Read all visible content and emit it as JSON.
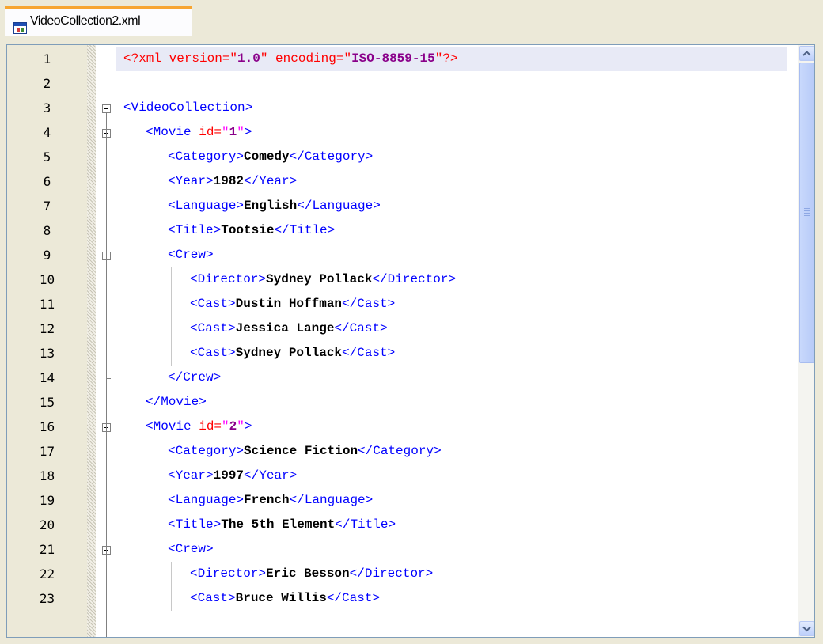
{
  "tab": {
    "label": "VideoCollection2.xml",
    "icon": "xml-file-icon"
  },
  "editor": {
    "current_line": 1,
    "lines": [
      {
        "n": "1",
        "indent": 0,
        "tokens": [
          [
            "pi",
            "<?xml version=\""
          ],
          [
            "val",
            "1.0"
          ],
          [
            "pi",
            "\" encoding=\""
          ],
          [
            "val",
            "ISO-8859-15"
          ],
          [
            "pi",
            "\"?>"
          ]
        ]
      },
      {
        "n": "2",
        "indent": 0,
        "tokens": []
      },
      {
        "n": "3",
        "indent": 0,
        "tokens": [
          [
            "tag",
            "<VideoCollection>"
          ]
        ]
      },
      {
        "n": "4",
        "indent": 1,
        "tokens": [
          [
            "tag",
            "<Movie "
          ],
          [
            "attr",
            "id="
          ],
          [
            "q",
            "\""
          ],
          [
            "val",
            "1"
          ],
          [
            "q",
            "\""
          ],
          [
            "tag",
            ">"
          ]
        ]
      },
      {
        "n": "5",
        "indent": 2,
        "tokens": [
          [
            "tag",
            "<Category>"
          ],
          [
            "txt",
            "Comedy"
          ],
          [
            "tag",
            "</Category>"
          ]
        ]
      },
      {
        "n": "6",
        "indent": 2,
        "tokens": [
          [
            "tag",
            "<Year>"
          ],
          [
            "txt",
            "1982"
          ],
          [
            "tag",
            "</Year>"
          ]
        ]
      },
      {
        "n": "7",
        "indent": 2,
        "tokens": [
          [
            "tag",
            "<Language>"
          ],
          [
            "txt",
            "English"
          ],
          [
            "tag",
            "</Language>"
          ]
        ]
      },
      {
        "n": "8",
        "indent": 2,
        "tokens": [
          [
            "tag",
            "<Title>"
          ],
          [
            "txt",
            "Tootsie"
          ],
          [
            "tag",
            "</Title>"
          ]
        ]
      },
      {
        "n": "9",
        "indent": 2,
        "tokens": [
          [
            "tag",
            "<Crew>"
          ]
        ]
      },
      {
        "n": "10",
        "indent": 3,
        "tokens": [
          [
            "tag",
            "<Director>"
          ],
          [
            "txt",
            "Sydney Pollack"
          ],
          [
            "tag",
            "</Director>"
          ]
        ]
      },
      {
        "n": "11",
        "indent": 3,
        "tokens": [
          [
            "tag",
            "<Cast>"
          ],
          [
            "txt",
            "Dustin Hoffman"
          ],
          [
            "tag",
            "</Cast>"
          ]
        ]
      },
      {
        "n": "12",
        "indent": 3,
        "tokens": [
          [
            "tag",
            "<Cast>"
          ],
          [
            "txt",
            "Jessica Lange"
          ],
          [
            "tag",
            "</Cast>"
          ]
        ]
      },
      {
        "n": "13",
        "indent": 3,
        "tokens": [
          [
            "tag",
            "<Cast>"
          ],
          [
            "txt",
            "Sydney Pollack"
          ],
          [
            "tag",
            "</Cast>"
          ]
        ]
      },
      {
        "n": "14",
        "indent": 2,
        "tokens": [
          [
            "tag",
            "</Crew>"
          ]
        ]
      },
      {
        "n": "15",
        "indent": 1,
        "tokens": [
          [
            "tag",
            "</Movie>"
          ]
        ]
      },
      {
        "n": "16",
        "indent": 1,
        "tokens": [
          [
            "tag",
            "<Movie "
          ],
          [
            "attr",
            "id="
          ],
          [
            "q",
            "\""
          ],
          [
            "val",
            "2"
          ],
          [
            "q",
            "\""
          ],
          [
            "tag",
            ">"
          ]
        ]
      },
      {
        "n": "17",
        "indent": 2,
        "tokens": [
          [
            "tag",
            "<Category>"
          ],
          [
            "txt",
            "Science Fiction"
          ],
          [
            "tag",
            "</Category>"
          ]
        ]
      },
      {
        "n": "18",
        "indent": 2,
        "tokens": [
          [
            "tag",
            "<Year>"
          ],
          [
            "txt",
            "1997"
          ],
          [
            "tag",
            "</Year>"
          ]
        ]
      },
      {
        "n": "19",
        "indent": 2,
        "tokens": [
          [
            "tag",
            "<Language>"
          ],
          [
            "txt",
            "French"
          ],
          [
            "tag",
            "</Language>"
          ]
        ]
      },
      {
        "n": "20",
        "indent": 2,
        "tokens": [
          [
            "tag",
            "<Title>"
          ],
          [
            "txt",
            "The 5th Element"
          ],
          [
            "tag",
            "</Title>"
          ]
        ]
      },
      {
        "n": "21",
        "indent": 2,
        "tokens": [
          [
            "tag",
            "<Crew>"
          ]
        ]
      },
      {
        "n": "22",
        "indent": 3,
        "tokens": [
          [
            "tag",
            "<Director>"
          ],
          [
            "txt",
            "Eric Besson"
          ],
          [
            "tag",
            "</Director>"
          ]
        ]
      },
      {
        "n": "23",
        "indent": 3,
        "tokens": [
          [
            "tag",
            "<Cast>"
          ],
          [
            "txt",
            "Bruce Willis"
          ],
          [
            "tag",
            "</Cast>"
          ]
        ]
      }
    ]
  },
  "scrollbar": {
    "up_icon": "scroll-up-arrow-icon",
    "down_icon": "scroll-down-arrow-icon"
  }
}
